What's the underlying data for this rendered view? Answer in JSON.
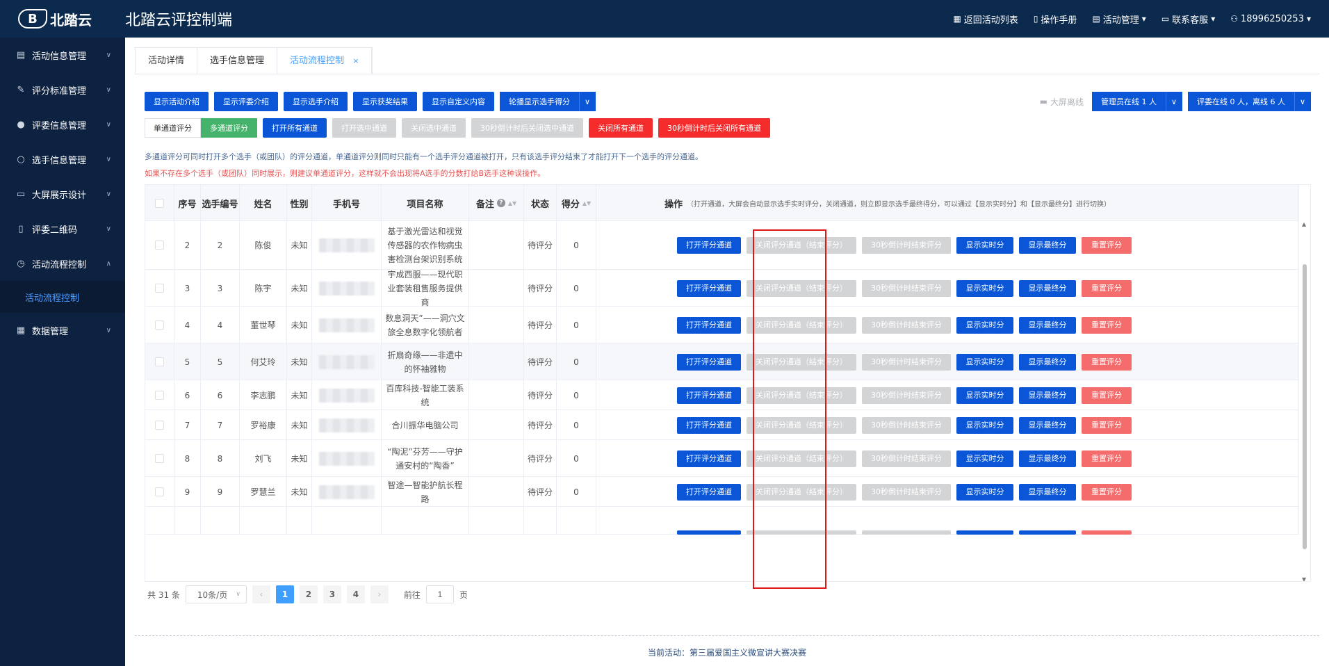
{
  "header": {
    "logo_text": "北踏云",
    "title": "北踏云评控制端",
    "links": [
      {
        "label": "返回活动列表",
        "icon": "grid-icon"
      },
      {
        "label": "操作手册",
        "icon": "book-icon"
      },
      {
        "label": "活动管理",
        "icon": "doc-icon",
        "dropdown": true
      },
      {
        "label": "联系客服",
        "icon": "chat-icon",
        "dropdown": true
      },
      {
        "label": "18996250253",
        "icon": "user-icon",
        "dropdown": true
      }
    ]
  },
  "sidebar": {
    "items": [
      {
        "label": "活动信息管理",
        "icon": "document-icon"
      },
      {
        "label": "评分标准管理",
        "icon": "edit-icon"
      },
      {
        "label": "评委信息管理",
        "icon": "person-icon"
      },
      {
        "label": "选手信息管理",
        "icon": "user-outline-icon"
      },
      {
        "label": "大屏展示设计",
        "icon": "monitor-icon"
      },
      {
        "label": "评委二维码",
        "icon": "phone-icon"
      },
      {
        "label": "活动流程控制",
        "icon": "alarm-icon",
        "expanded": true
      },
      {
        "label": "数据管理",
        "icon": "calendar-icon"
      }
    ],
    "sub_item": "活动流程控制"
  },
  "tabs": [
    {
      "label": "活动详情"
    },
    {
      "label": "选手信息管理"
    },
    {
      "label": "活动流程控制",
      "active": true,
      "closable": "×"
    }
  ],
  "toolbar": {
    "row1": [
      "显示活动介绍",
      "显示评委介绍",
      "显示选手介绍",
      "显示获奖结果",
      "显示自定义内容",
      "轮播显示选手得分"
    ],
    "offline_label": "大屏离线",
    "admin_online": "管理员在线 1 人",
    "judge_online": "评委在线 0 人，离线 6 人",
    "mode_single": "单通道评分",
    "mode_multi": "多通道评分",
    "row2": {
      "open_all": "打开所有通道",
      "open_selected": "打开选中通道",
      "close_selected": "关闭选中通道",
      "countdown_close_selected": "30秒倒计时后关闭选中通道",
      "close_all": "关闭所有通道",
      "countdown_close_all": "30秒倒计时后关闭所有通道"
    }
  },
  "info": {
    "line1": "多通道评分可同时打开多个选手（或团队）的评分通道，单通道评分则同时只能有一个选手评分通道被打开，只有该选手评分结束了才能打开下一个选手的评分通道。",
    "line2": "如果不存在多个选手（或团队）同时展示，则建议单通道评分，这样就不会出现将A选手的分数打给B选手这种误操作。"
  },
  "table": {
    "headers": {
      "index": "序号",
      "number": "选手编号",
      "name": "姓名",
      "gender": "性别",
      "phone": "手机号",
      "project": "项目名称",
      "remark": "备注",
      "status": "状态",
      "score": "得分",
      "ops": "操作",
      "ops_note": "（打开通道，大屏会自动显示选手实时评分，关闭通道，则立即显示选手最终得分，可以通过【显示实时分】和【显示最终分】进行切换）"
    },
    "op_labels": {
      "open": "打开评分通道",
      "close": "关闭评分通道（结束评分）",
      "countdown": "30秒倒计时结束评分",
      "show_live": "显示实时分",
      "show_final": "显示最终分",
      "reset": "重置评分"
    },
    "rows": [
      {
        "index": "2",
        "number": "2",
        "name": "陈俊",
        "gender": "未知",
        "project": "基于激光雷达和视觉传感器的农作物病虫害检测台架识别系统",
        "status": "待评分",
        "score": "0"
      },
      {
        "index": "3",
        "number": "3",
        "name": "陈宇",
        "gender": "未知",
        "project": "宇成西服——现代职业套装租售服务提供商",
        "status": "待评分",
        "score": "0"
      },
      {
        "index": "4",
        "number": "4",
        "name": "董世琴",
        "gender": "未知",
        "project": "数息洞天”——洞穴文旅全息数字化领航者",
        "status": "待评分",
        "score": "0"
      },
      {
        "index": "5",
        "number": "5",
        "name": "何艾玲",
        "gender": "未知",
        "project": "折扇奇缘——非遗中的怀袖雅物",
        "status": "待评分",
        "score": "0"
      },
      {
        "index": "6",
        "number": "6",
        "name": "李志鹏",
        "gender": "未知",
        "project": "百库科技-智能工装系统",
        "status": "待评分",
        "score": "0"
      },
      {
        "index": "7",
        "number": "7",
        "name": "罗裕康",
        "gender": "未知",
        "project": "合川振华电脑公司",
        "status": "待评分",
        "score": "0"
      },
      {
        "index": "8",
        "number": "8",
        "name": "刘飞",
        "gender": "未知",
        "project": "“陶泥”芬芳——守护通安村的“陶香”",
        "status": "待评分",
        "score": "0"
      },
      {
        "index": "9",
        "number": "9",
        "name": "罗慧兰",
        "gender": "未知",
        "project": "智途—智能护航长程路",
        "status": "待评分",
        "score": "0"
      }
    ]
  },
  "pagination": {
    "total": "共 31 条",
    "page_size": "10条/页",
    "pages": [
      "1",
      "2",
      "3",
      "4"
    ],
    "current": "1",
    "goto_prefix": "前往",
    "goto_value": "1",
    "goto_suffix": "页"
  },
  "footer": {
    "text": "当前活动：第三届爱国主义微宣讲大赛决赛"
  },
  "colors": {
    "header_bg": "#0b2a4d",
    "sidebar_bg": "#0d2240",
    "primary": "#0a56d6",
    "danger": "#f52c2c",
    "success": "#45b36b",
    "highlight": "#e01515"
  }
}
